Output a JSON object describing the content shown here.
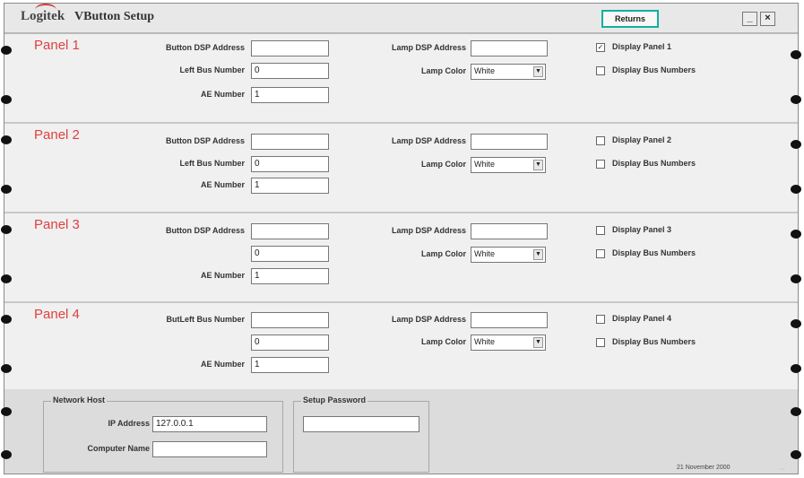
{
  "app": {
    "logo": "Logitek",
    "title": "VButton Setup",
    "returns_label": "Returns",
    "minimize_label": "_",
    "close_label": "×"
  },
  "labels": {
    "button_dsp_address": "Button DSP Address",
    "left_bus_number": "Left Bus Number",
    "ae_number": "AE Number",
    "lamp_dsp_address": "Lamp DSP Address",
    "lamp_color": "Lamp Color",
    "display_bus_numbers": "Display Bus Numbers",
    "panel4_first_label": "ButLeft Bus Number"
  },
  "panels": [
    {
      "title": "Panel 1",
      "button_dsp_address": "",
      "left_bus_number": "0",
      "ae_number": "1",
      "lamp_dsp_address": "",
      "lamp_color": "White",
      "display_panel_label": "Display Panel 1",
      "display_panel_checked": true,
      "display_bus_numbers_checked": false
    },
    {
      "title": "Panel 2",
      "button_dsp_address": "",
      "left_bus_number": "0",
      "ae_number": "1",
      "lamp_dsp_address": "",
      "lamp_color": "White",
      "display_panel_label": "Display Panel 2",
      "display_panel_checked": false,
      "display_bus_numbers_checked": false
    },
    {
      "title": "Panel 3",
      "button_dsp_address": "",
      "left_bus_number": "0",
      "ae_number": "1",
      "lamp_dsp_address": "",
      "lamp_color": "White",
      "display_panel_label": "Display Panel 3",
      "display_panel_checked": false,
      "display_bus_numbers_checked": false
    },
    {
      "title": "Panel 4",
      "button_dsp_address": "",
      "left_bus_number": "0",
      "ae_number": "1",
      "lamp_dsp_address": "",
      "lamp_color": "White",
      "display_panel_label": "Display Panel 4",
      "display_panel_checked": false,
      "display_bus_numbers_checked": false
    }
  ],
  "network": {
    "group_title": "Network Host",
    "ip_label": "IP Address",
    "ip_value": "127.0.0.1",
    "computer_name_label": "Computer Name",
    "computer_name_value": ""
  },
  "password": {
    "group_title": "Setup Password",
    "value": ""
  },
  "footer": {
    "date": "21 November 2000"
  },
  "colors": {
    "panel_title": "#e04040",
    "returns_border": "#12b0a0"
  }
}
